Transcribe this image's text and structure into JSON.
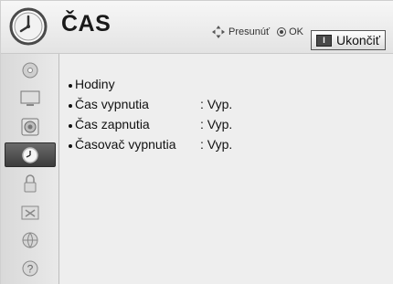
{
  "header": {
    "title": "ČAS",
    "hint_move": "Presunúť",
    "hint_ok": "OK",
    "exit_label": "Ukončiť",
    "exit_key": "I",
    "icon": "clock-icon"
  },
  "sidebar": {
    "items": [
      {
        "icon": "disc-icon",
        "active": false
      },
      {
        "icon": "tv-screen-icon",
        "active": false
      },
      {
        "icon": "speaker-icon",
        "active": false
      },
      {
        "icon": "clock-icon",
        "active": true
      },
      {
        "icon": "lock-icon",
        "active": false
      },
      {
        "icon": "toolbox-icon",
        "active": false
      },
      {
        "icon": "network-globe-icon",
        "active": false
      },
      {
        "icon": "help-icon",
        "active": false
      }
    ]
  },
  "menu": {
    "items": [
      {
        "label": "Hodiny",
        "value": ""
      },
      {
        "label": "Čas vypnutia",
        "value": ": Vyp."
      },
      {
        "label": "Čas zapnutia",
        "value": ": Vyp."
      },
      {
        "label": "Časovač vypnutia",
        "value": ": Vyp."
      }
    ]
  },
  "colors": {
    "background": "#ececec",
    "active_item": "#4a4a4a",
    "text": "#111111"
  }
}
